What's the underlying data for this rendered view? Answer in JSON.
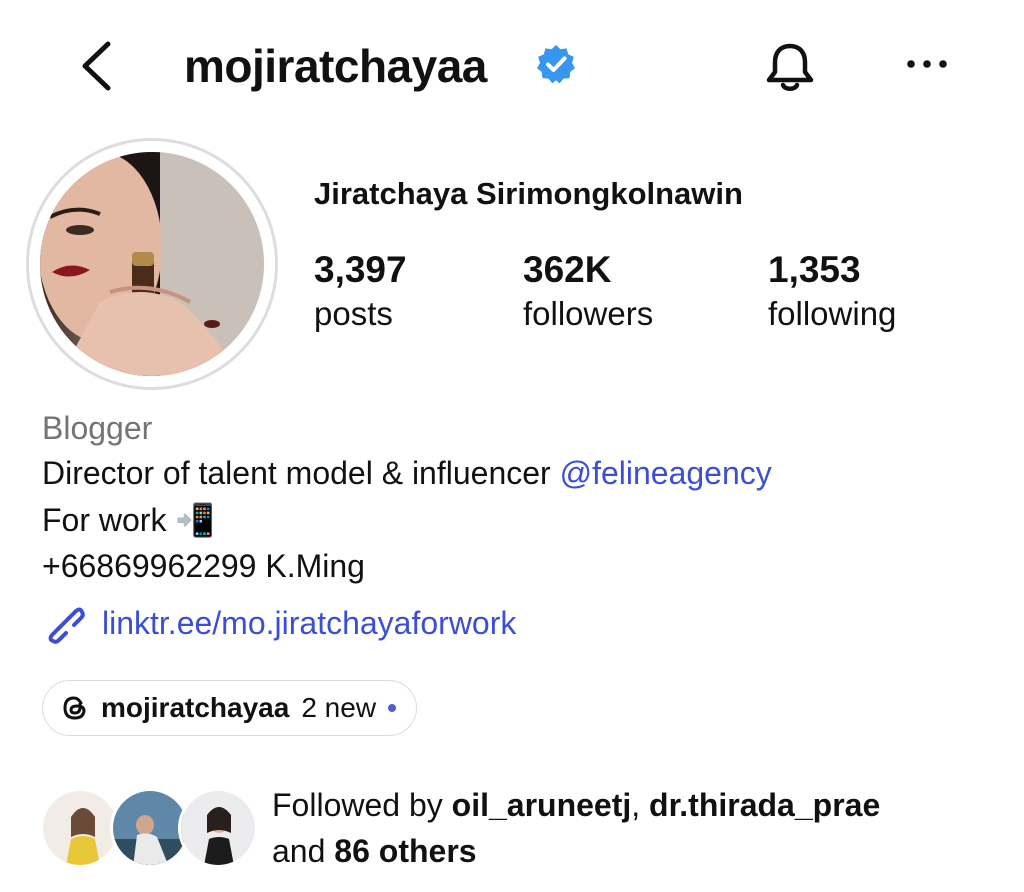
{
  "header": {
    "username": "mojiratchayaa",
    "icons": [
      "chevron-left-icon",
      "verified-badge-icon",
      "bell-icon",
      "more-icon"
    ]
  },
  "profile": {
    "full_name": "Jiratchaya Sirimongkolnawin",
    "stats": [
      {
        "value": "3,397",
        "label": "posts"
      },
      {
        "value": "362K",
        "label": "followers"
      },
      {
        "value": "1,353",
        "label": "following"
      }
    ]
  },
  "bio": {
    "category": "Blogger",
    "line1_text": "Director of talent model & influencer ",
    "line1_mention": "@felineagency",
    "line2_text": "For work",
    "line2_emoji": "📲",
    "line3_text": "+66869962299 K.Ming",
    "link": "linktr.ee/mo.jiratchayaforwork"
  },
  "threads": {
    "name": "mojiratchayaa",
    "badge": "2 new"
  },
  "followed_by": {
    "prefix": "Followed by ",
    "user1": "oil_aruneetj",
    "sep": ", ",
    "user2": "dr.thirada_prae",
    "and": "and ",
    "others": "86 others"
  },
  "colors": {
    "link": "#3b4fd6",
    "verified": "#3797f0",
    "secondary": "#737378"
  }
}
